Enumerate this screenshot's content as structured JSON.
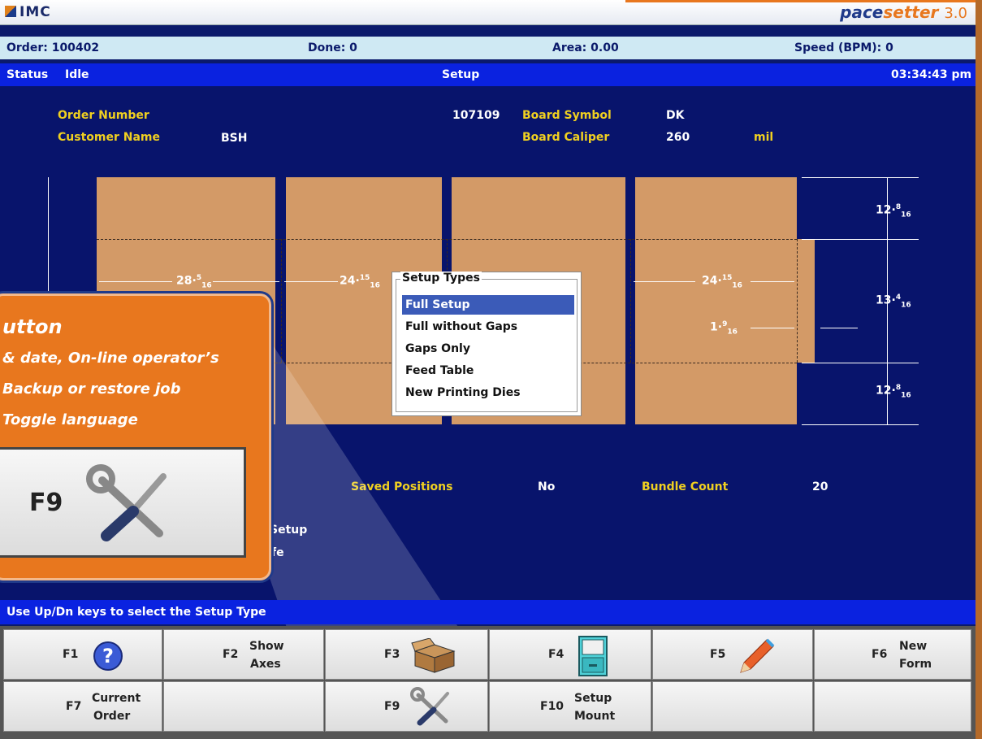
{
  "app": {
    "logo_text": "IMC",
    "brand_part1": "pace",
    "brand_part2": "setter",
    "brand_version": "3.0"
  },
  "info": {
    "order": "Order: 100402",
    "done": "Done: 0",
    "area": "Area: 0.00",
    "speed": "Speed (BPM): 0"
  },
  "status": {
    "label": "Status",
    "value": "Idle",
    "mode": "Setup",
    "time": "03:34:43 pm"
  },
  "order_info": {
    "order_number_label": "Order Number",
    "order_number_value": "107109",
    "customer_name_label": "Customer Name",
    "customer_name_value": "BSH",
    "board_symbol_label": "Board Symbol",
    "board_symbol_value": "DK",
    "board_caliper_label": "Board Caliper",
    "board_caliper_value": "260",
    "board_caliper_unit": "mil"
  },
  "dimensions": {
    "d1_whole": "28·",
    "d1_num": "5",
    "d1_den": "16",
    "d2_whole": "24·",
    "d2_num": "15",
    "d2_den": "16",
    "d3_whole": "24·",
    "d3_num": "15",
    "d3_den": "16",
    "d4_whole": "1·",
    "d4_num": "9",
    "d4_den": "16",
    "r1_whole": "12·",
    "r1_num": "8",
    "r1_den": "16",
    "r2_whole": "13·",
    "r2_num": "4",
    "r2_den": "16",
    "r3_whole": "12·",
    "r3_num": "8",
    "r3_den": "16"
  },
  "popup": {
    "title": "Setup Types",
    "items": [
      "Full Setup",
      "Full without Gaps",
      "Gaps Only",
      "Feed Table",
      "New Printing Dies"
    ],
    "selected_index": 0
  },
  "lower_info": {
    "saved_positions_label": "Saved Positions",
    "saved_positions_value": "No",
    "bundle_count_label": "Bundle Count",
    "bundle_count_value": "20",
    "partial_1": "Setup",
    "partial_2": "fe"
  },
  "callout": {
    "title": "utton",
    "line1": "& date, On-line operator’s",
    "line2": "Backup or restore job",
    "line3": "Toggle language",
    "key": "F9"
  },
  "hint": "Use Up/Dn keys to select the Setup Type",
  "fkeys": {
    "f1": "F1",
    "f2": "F2",
    "f2_l1": "Show",
    "f2_l2": "Axes",
    "f3": "F3",
    "f4": "F4",
    "f5": "F5",
    "f6": "F6",
    "f6_l1": "New",
    "f6_l2": "Form",
    "f7": "F7",
    "f7_l1": "Current",
    "f7_l2": "Order",
    "f9": "F9",
    "f10": "F10",
    "f10_l1": "Setup",
    "f10_l2": "Mount"
  },
  "colors": {
    "background": "#08146c",
    "status_bar": "#0a22e0",
    "label_yellow": "#f0d020",
    "board": "#d39a67",
    "callout_orange": "#e8771e",
    "selection": "#3b5bb8"
  }
}
